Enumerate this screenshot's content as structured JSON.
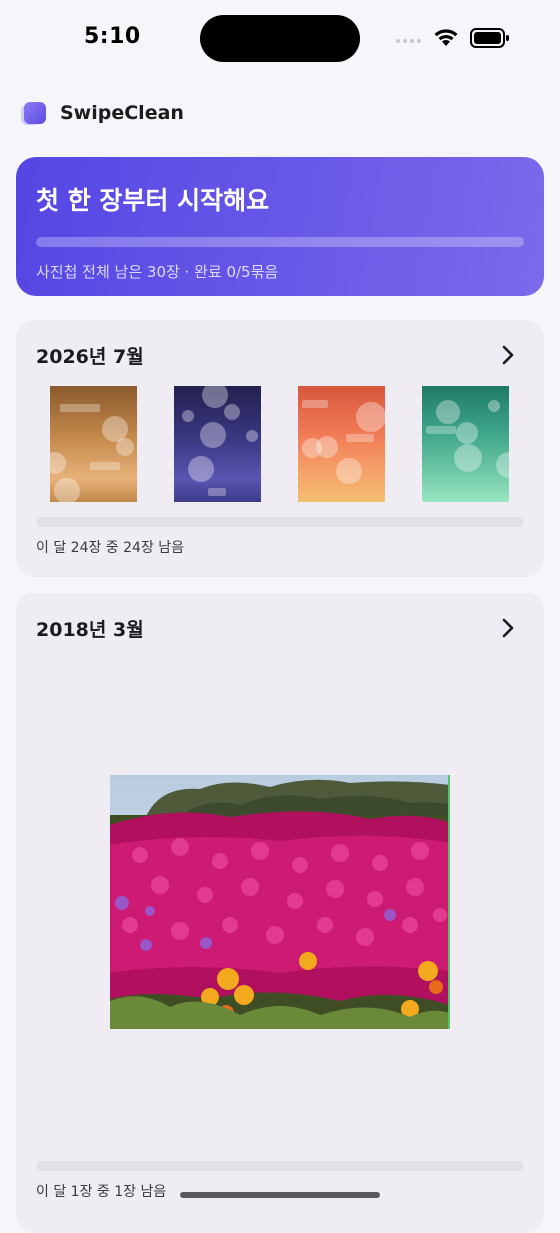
{
  "status_bar": {
    "time": "5:10"
  },
  "app": {
    "title": "SwipeClean"
  },
  "hero": {
    "title": "첫 한 장부터 시작해요",
    "subtitle": "사진첩 전체 남은 30장 · 완료 0/5묶음",
    "progress": 0
  },
  "months": [
    {
      "title": "2026년 7월",
      "remaining_text": "이 달 24장 중 24장 남음",
      "progress": 0,
      "thumb_colors": [
        "#c58a4c",
        "#3b3782",
        "#f07a55",
        "#3ea58a"
      ]
    },
    {
      "title": "2018년 3월",
      "remaining_text": "이 달 1장 중 1장 남음",
      "progress": 0,
      "photo_subject": "magenta-flower-field-photo"
    }
  ],
  "colors": {
    "accent": "#5b4ae6",
    "card_bg": "#efedf3",
    "page_bg": "#f6f5f9"
  }
}
